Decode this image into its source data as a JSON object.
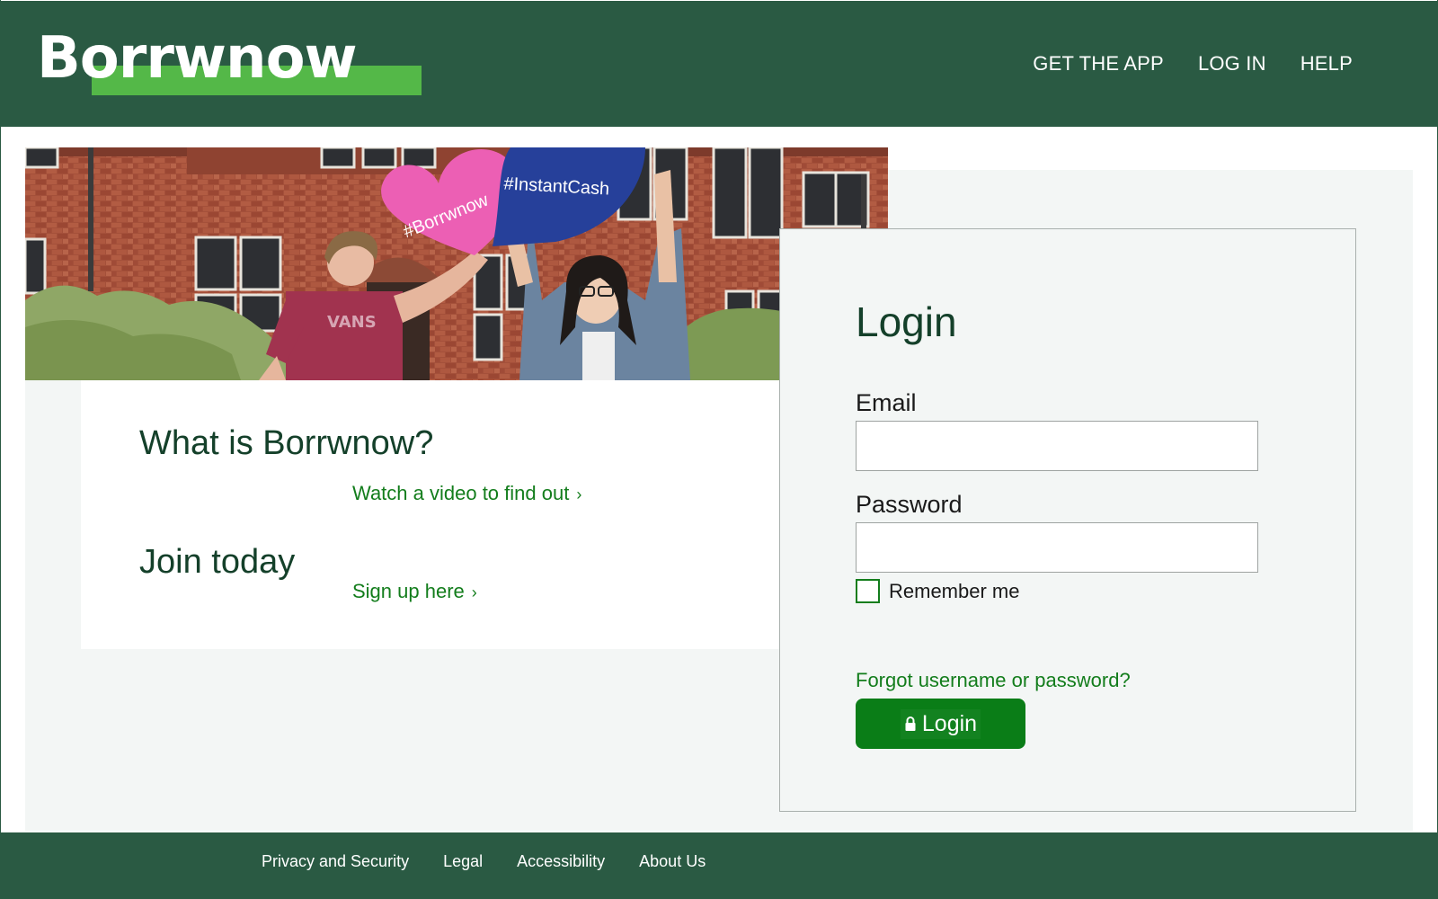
{
  "brand": {
    "name": "Borrwnow",
    "colors": {
      "primary": "#2a5a43",
      "accent": "#54b848",
      "link": "#137d1c",
      "button": "#0a7d17"
    }
  },
  "nav": {
    "items": [
      {
        "label": "GET THE APP"
      },
      {
        "label": "LOG IN"
      },
      {
        "label": "HELP"
      }
    ]
  },
  "hero": {
    "signs": [
      {
        "text": "#Borrwnow",
        "color": "#ec5fb4"
      },
      {
        "text": "#InstantCash",
        "color": "#26409a"
      }
    ]
  },
  "info": {
    "what_heading": "What is Borrwnow?",
    "video_link": "Watch a video to find out",
    "join_heading": "Join today",
    "signup_link": "Sign up here",
    "chevron_icon": "chevron-right-icon"
  },
  "login": {
    "title": "Login",
    "email_label": "Email",
    "email_value": "",
    "password_label": "Password",
    "password_value": "",
    "remember_label": "Remember me",
    "remember_checked": false,
    "forgot_link": "Forgot username or password?",
    "button_label": "Login",
    "button_icon": "lock-icon"
  },
  "footer": {
    "links": [
      {
        "label": "Privacy and Security"
      },
      {
        "label": "Legal"
      },
      {
        "label": "Accessibility"
      },
      {
        "label": "About Us"
      }
    ]
  }
}
